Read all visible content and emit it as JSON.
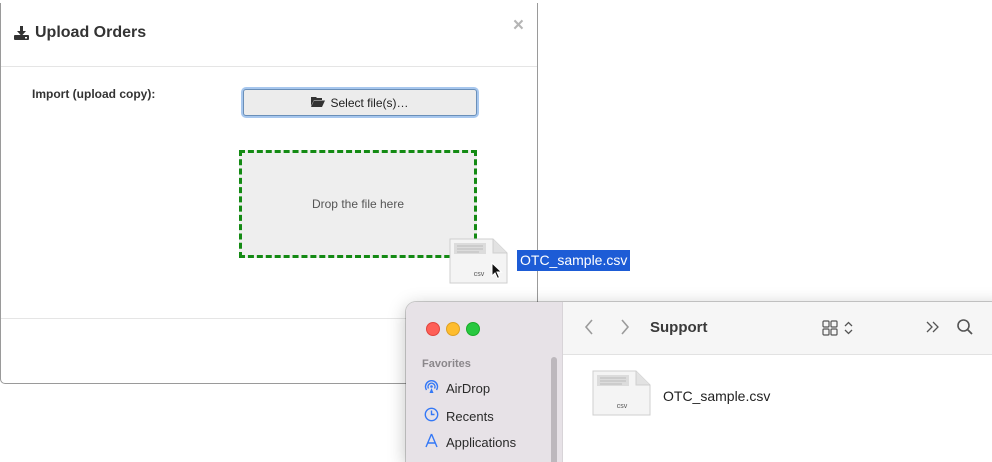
{
  "modal": {
    "title": "Upload Orders",
    "close_glyph": "×",
    "import_label": "Import (upload copy):",
    "select_button_label": "Select file(s)…",
    "drop_zone_text": "Drop the file here"
  },
  "drag": {
    "file_name": "OTC_sample.csv",
    "file_badge": "csv"
  },
  "finder": {
    "folder_title": "Support",
    "sidebar_section": "Favorites",
    "sidebar_items": [
      {
        "label": "AirDrop",
        "icon": "airdrop-icon"
      },
      {
        "label": "Recents",
        "icon": "clock-icon"
      },
      {
        "label": "Applications",
        "icon": "applications-icon"
      }
    ],
    "files": [
      {
        "name": "OTC_sample.csv",
        "badge": "csv"
      }
    ]
  },
  "colors": {
    "drop_border": "#138a13",
    "selection_blue": "#1d5cd6",
    "traffic_red": "#fe5f57",
    "traffic_yellow": "#febc2e",
    "traffic_green": "#28c840"
  }
}
